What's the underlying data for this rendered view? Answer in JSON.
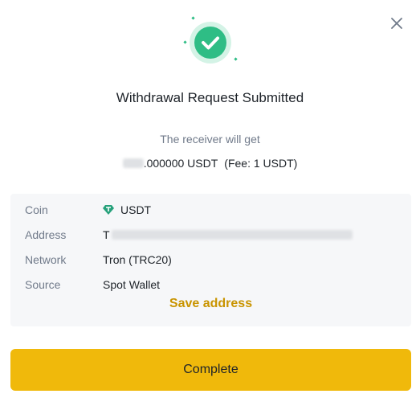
{
  "dialog": {
    "title": "Withdrawal Request Submitted",
    "receiver_label": "The receiver will get",
    "amount_suffix": ".000000 USDT",
    "fee_text": "(Fee: 1 USDT)"
  },
  "details": {
    "coin": {
      "label": "Coin",
      "value": "USDT",
      "icon": "tether-diamond-icon"
    },
    "address": {
      "label": "Address",
      "value_prefix": "T"
    },
    "network": {
      "label": "Network",
      "value": "Tron (TRC20)"
    },
    "source": {
      "label": "Source",
      "value": "Spot Wallet"
    }
  },
  "actions": {
    "save_address": "Save address",
    "complete": "Complete"
  },
  "colors": {
    "success": "#2ebd85",
    "accent": "#f0b90b",
    "link": "#c99400",
    "muted": "#707a8a",
    "panel": "#f6f7f9",
    "coin_icon": "#26a17b"
  }
}
